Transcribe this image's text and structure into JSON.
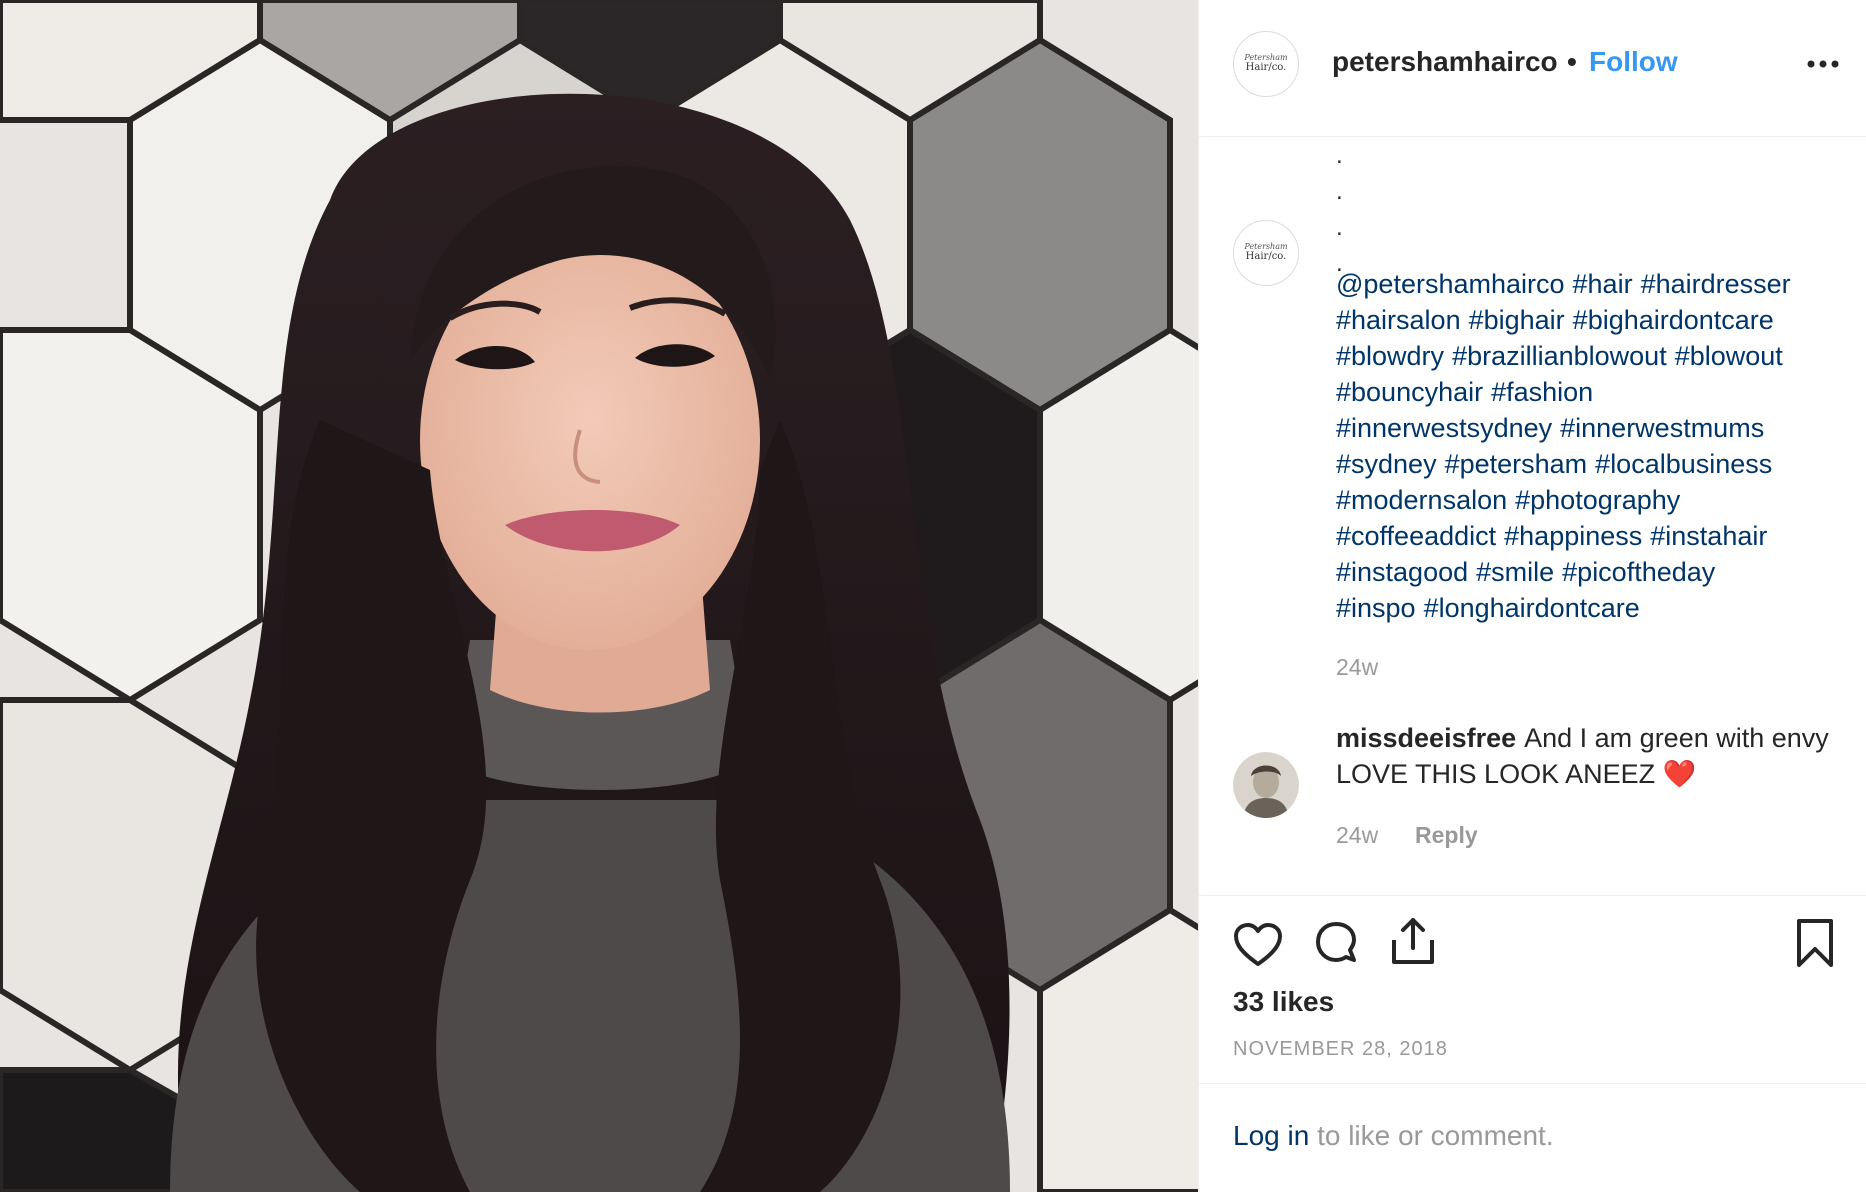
{
  "post": {
    "username": "petershamhairco",
    "separator": "•",
    "follow_label": "Follow",
    "avatar_logo_text": "Hair/co."
  },
  "caption": {
    "dots": [
      ".",
      ".",
      ".",
      "."
    ],
    "lines": [
      [
        "@petershamhairco",
        "#hair",
        "#hairdresser"
      ],
      [
        "#hairsalon",
        "#bighair",
        "#bighairdontcare"
      ],
      [
        "#blowdry",
        "#brazillianblowout",
        "#blowout"
      ],
      [
        "#bouncyhair",
        "#fashion"
      ],
      [
        "#innerwestsydney",
        "#innerwestmums"
      ],
      [
        "#sydney",
        "#petersham",
        "#localbusiness"
      ],
      [
        "#modernsalon",
        "#photography"
      ],
      [
        "#coffeeaddict",
        "#happiness",
        "#instahair"
      ],
      [
        "#instagood",
        "#smile",
        "#picoftheday"
      ],
      [
        "#inspo",
        "#longhairdontcare"
      ]
    ],
    "time": "24w"
  },
  "comment": {
    "username": "missdeeisfree",
    "text": "And I am green with envy LOVE THIS LOOK ANEEZ",
    "emoji": "❤️",
    "time": "24w",
    "reply_label": "Reply"
  },
  "actions": {
    "likes": "33 likes",
    "date": "NOVEMBER 28, 2018",
    "icons": [
      "heart-icon",
      "comment-icon",
      "share-icon",
      "bookmark-icon"
    ]
  },
  "login": {
    "link_label": "Log in",
    "rest_text": " to like or comment."
  },
  "colors": {
    "link": "#003569",
    "follow": "#3897f0",
    "muted": "#999999",
    "text": "#262626",
    "heart": "#e0245e"
  }
}
